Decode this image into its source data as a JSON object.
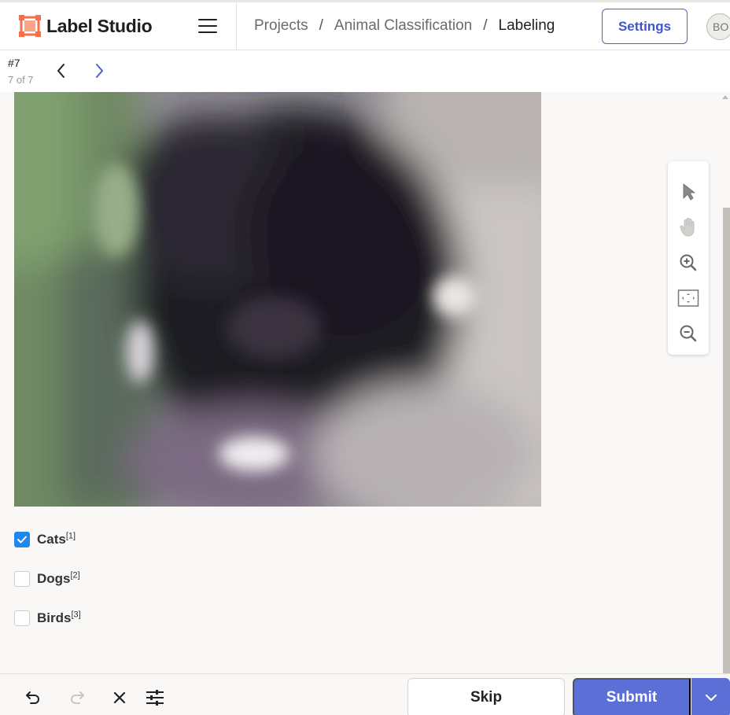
{
  "app": {
    "name": "Label Studio",
    "brand_color": "#f76f4a",
    "accent": "#3f58c6"
  },
  "header": {
    "breadcrumb": [
      {
        "label": "Projects"
      },
      {
        "label": "Animal Classification"
      },
      {
        "label": "Labeling"
      }
    ],
    "separator": "/",
    "settings_label": "Settings",
    "avatar_initials": "BO"
  },
  "task": {
    "id_label": "#7",
    "position_label": "7 of 7"
  },
  "tools": [
    "pointer-icon",
    "hand-pan-icon",
    "zoom-in-icon",
    "zoom-to-fit-icon",
    "zoom-out-icon"
  ],
  "choices": [
    {
      "label": "Cats",
      "hotkey": "[1]",
      "checked": true
    },
    {
      "label": "Dogs",
      "hotkey": "[2]",
      "checked": false
    },
    {
      "label": "Birds",
      "hotkey": "[3]",
      "checked": false
    }
  ],
  "footer": {
    "icons": [
      "undo-icon",
      "redo-icon",
      "reset-icon",
      "settings-sliders-icon"
    ],
    "skip_label": "Skip",
    "submit_label": "Submit"
  }
}
